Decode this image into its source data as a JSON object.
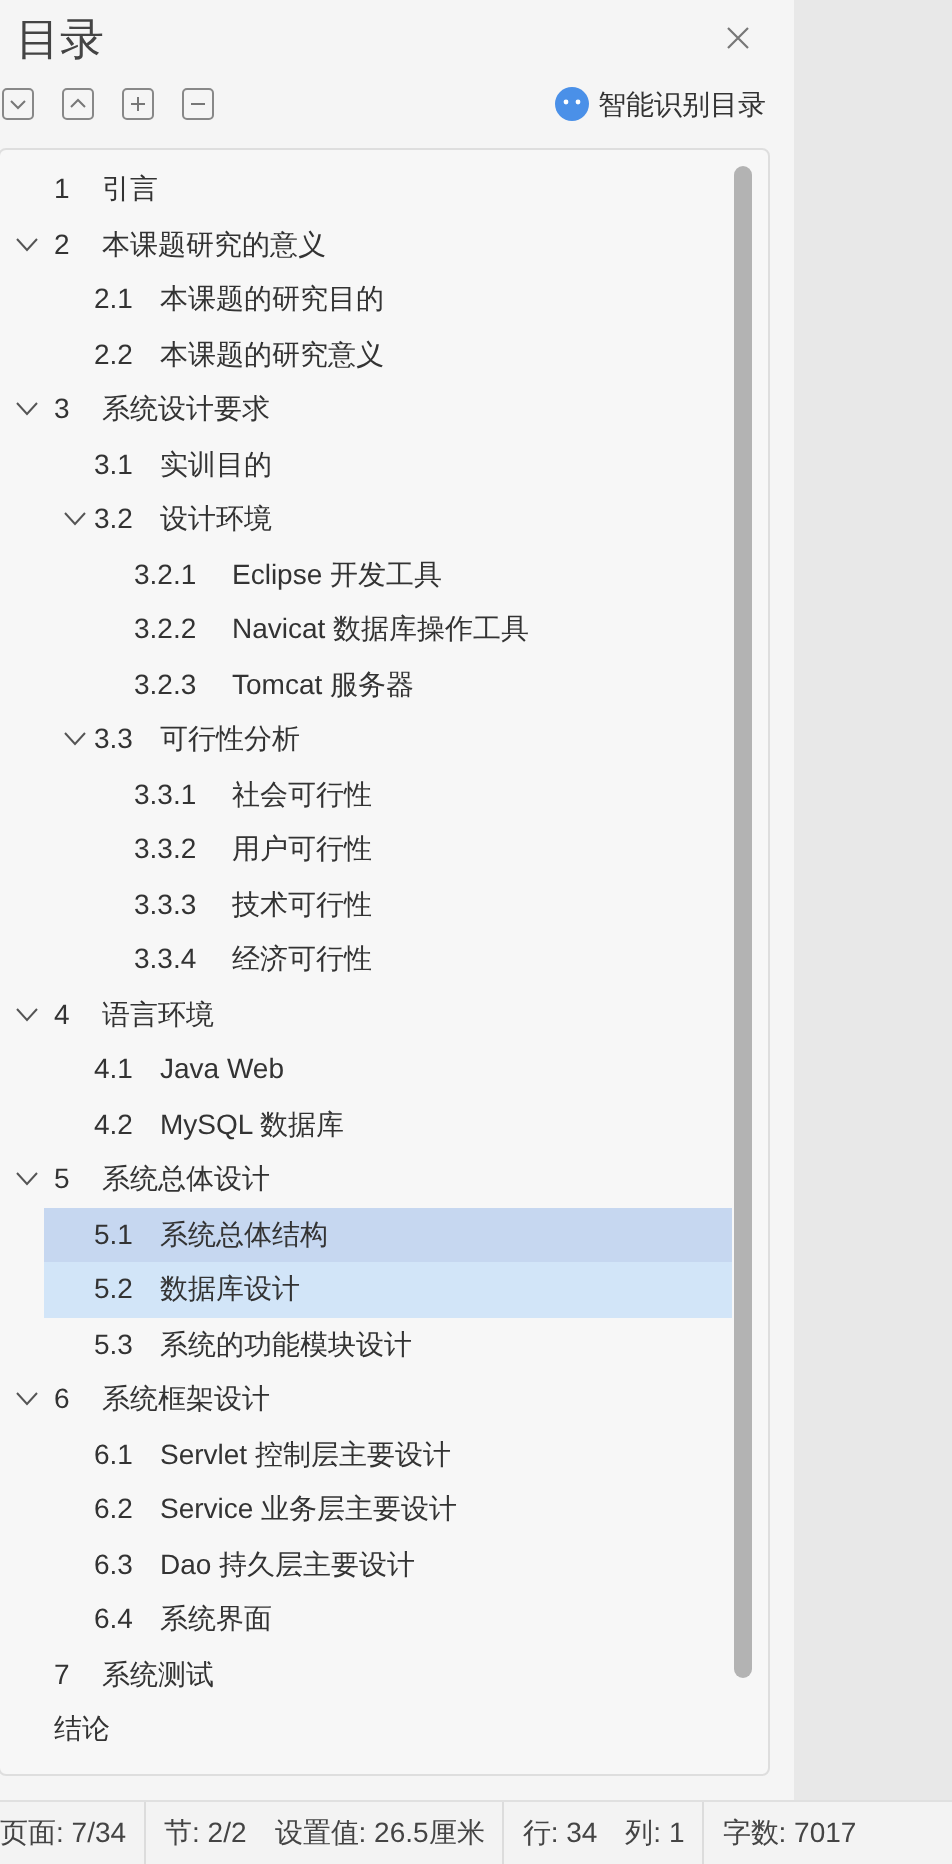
{
  "panel": {
    "title": "目录",
    "ai_button": "智能识别目录"
  },
  "toc": [
    {
      "number": "1",
      "title": "引言",
      "selected": false,
      "hovered": false
    },
    {
      "number": "2",
      "title": "本课题研究的意义",
      "selected": false,
      "hovered": false,
      "expanded": true,
      "children": [
        {
          "number": "2.1",
          "title": "本课题的研究目的",
          "selected": false,
          "hovered": false
        },
        {
          "number": "2.2",
          "title": "本课题的研究意义",
          "selected": false,
          "hovered": false
        }
      ]
    },
    {
      "number": "3",
      "title": "系统设计要求",
      "selected": false,
      "hovered": false,
      "expanded": true,
      "children": [
        {
          "number": "3.1",
          "title": "实训目的",
          "selected": false,
          "hovered": false
        },
        {
          "number": "3.2",
          "title": "设计环境",
          "selected": false,
          "hovered": false,
          "expanded": true,
          "children": [
            {
              "number": "3.2.1",
              "title": "Eclipse 开发工具",
              "selected": false,
              "hovered": false
            },
            {
              "number": "3.2.2",
              "title": "Navicat 数据库操作工具",
              "selected": false,
              "hovered": false
            },
            {
              "number": "3.2.3",
              "title": "Tomcat 服务器",
              "selected": false,
              "hovered": false
            }
          ]
        },
        {
          "number": "3.3",
          "title": "可行性分析",
          "selected": false,
          "hovered": false,
          "expanded": true,
          "children": [
            {
              "number": "3.3.1",
              "title": "社会可行性",
              "selected": false,
              "hovered": false
            },
            {
              "number": "3.3.2",
              "title": "用户可行性",
              "selected": false,
              "hovered": false
            },
            {
              "number": "3.3.3",
              "title": "技术可行性",
              "selected": false,
              "hovered": false
            },
            {
              "number": "3.3.4",
              "title": "经济可行性",
              "selected": false,
              "hovered": false
            }
          ]
        }
      ]
    },
    {
      "number": "4",
      "title": "语言环境",
      "selected": false,
      "hovered": false,
      "expanded": true,
      "children": [
        {
          "number": "4.1",
          "title": "Java Web",
          "selected": false,
          "hovered": false
        },
        {
          "number": "4.2",
          "title": "MySQL 数据库",
          "selected": false,
          "hovered": false
        }
      ]
    },
    {
      "number": "5",
      "title": "系统总体设计",
      "selected": false,
      "hovered": false,
      "expanded": true,
      "children": [
        {
          "number": "5.1",
          "title": "系统总体结构",
          "selected": true,
          "hovered": false
        },
        {
          "number": "5.2",
          "title": "数据库设计",
          "selected": false,
          "hovered": true
        },
        {
          "number": "5.3",
          "title": "系统的功能模块设计",
          "selected": false,
          "hovered": false
        }
      ]
    },
    {
      "number": "6",
      "title": "系统框架设计",
      "selected": false,
      "hovered": false,
      "expanded": true,
      "children": [
        {
          "number": "6.1",
          "title": "Servlet 控制层主要设计",
          "selected": false,
          "hovered": false
        },
        {
          "number": "6.2",
          "title": "Service 业务层主要设计",
          "selected": false,
          "hovered": false
        },
        {
          "number": "6.3",
          "title": "Dao 持久层主要设计",
          "selected": false,
          "hovered": false
        },
        {
          "number": "6.4",
          "title": "系统界面",
          "selected": false,
          "hovered": false
        }
      ]
    },
    {
      "number": "7",
      "title": "系统测试",
      "selected": false,
      "hovered": false
    },
    {
      "title": "结论",
      "selected": false,
      "hovered": false
    }
  ],
  "status_bar": [
    [
      "页面: 7/34"
    ],
    [
      "节: 2/2",
      "设置值: 26.5厘米"
    ],
    [
      "行: 34",
      "列: 1"
    ],
    [
      "字数: 7017"
    ]
  ]
}
